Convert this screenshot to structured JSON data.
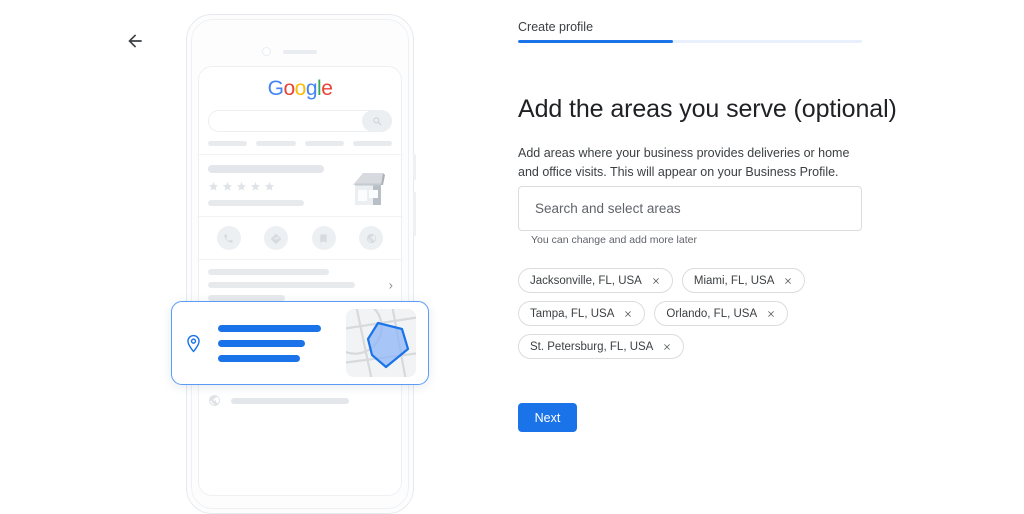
{
  "nav": {
    "back_icon": "arrow-left-icon"
  },
  "wizard": {
    "tab_label": "Create profile",
    "progress_percent": 45,
    "accent_color": "#1a73e8",
    "track_color": "#e8f0fe"
  },
  "main": {
    "heading": "Add the areas you serve (optional)",
    "body": "Add areas where your business provides deliveries or home and office visits. This will appear on your Business Profile.",
    "search": {
      "placeholder": "Search and select areas",
      "value": "",
      "hint": "You can change and add more later"
    },
    "chips": [
      {
        "label": "Jacksonville, FL, USA",
        "remove_icon": "close-icon"
      },
      {
        "label": "Miami, FL, USA",
        "remove_icon": "close-icon"
      },
      {
        "label": "Tampa, FL, USA",
        "remove_icon": "close-icon"
      },
      {
        "label": "Orlando, FL, USA",
        "remove_icon": "close-icon"
      },
      {
        "label": "St. Petersburg, FL, USA",
        "remove_icon": "close-icon"
      }
    ],
    "next_label": "Next"
  },
  "phone_preview": {
    "google_logo": {
      "letters": [
        "G",
        "o",
        "o",
        "g",
        "l",
        "e"
      ],
      "colors": [
        "#4285F4",
        "#EA4335",
        "#FBBC05",
        "#4285F4",
        "#34A853",
        "#EA4335"
      ]
    },
    "search_icon": "search-icon",
    "rating_stars": 5,
    "storefront_icon": "storefront-icon",
    "action_icons": [
      "phone-icon",
      "directions-icon",
      "bookmark-icon",
      "website-icon"
    ],
    "chevron_icon": "chevron-right-icon",
    "list_icons": [
      "clock-icon",
      "phone-icon",
      "globe-icon"
    ],
    "service_card": {
      "pin_icon": "location-pin-icon",
      "map_icon": "map-area-icon",
      "line_count": 3,
      "highlight_color": "#1a73e8"
    }
  }
}
